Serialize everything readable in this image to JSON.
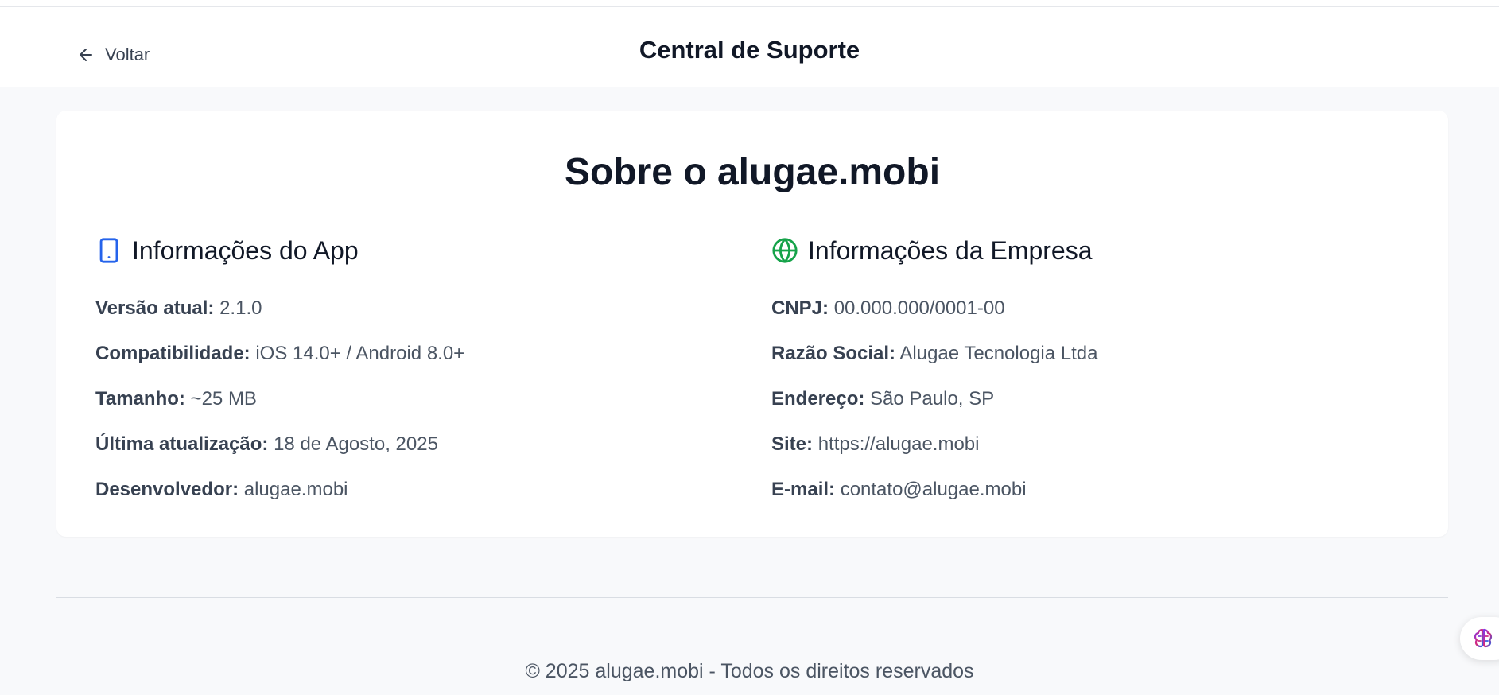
{
  "header": {
    "back_label": "Voltar",
    "title": "Central de Suporte"
  },
  "card": {
    "title": "Sobre o alugae.mobi",
    "app": {
      "heading": "Informações do App",
      "icon": "smartphone-icon",
      "rows": [
        {
          "label": "Versão atual:",
          "value": "2.1.0"
        },
        {
          "label": "Compatibilidade:",
          "value": "iOS 14.0+ / Android 8.0+"
        },
        {
          "label": "Tamanho:",
          "value": "~25 MB"
        },
        {
          "label": "Última atualização:",
          "value": "18 de Agosto, 2025"
        },
        {
          "label": "Desenvolvedor:",
          "value": "alugae.mobi"
        }
      ]
    },
    "company": {
      "heading": "Informações da Empresa",
      "icon": "globe-icon",
      "rows": [
        {
          "label": "CNPJ:",
          "value": "00.000.000/0001-00"
        },
        {
          "label": "Razão Social:",
          "value": "Alugae Tecnologia Ltda"
        },
        {
          "label": "Endereço:",
          "value": "São Paulo, SP"
        },
        {
          "label": "Site:",
          "value": "https://alugae.mobi"
        },
        {
          "label": "E-mail:",
          "value": "contato@alugae.mobi"
        }
      ]
    }
  },
  "footer": {
    "text": "© 2025 alugae.mobi - Todos os direitos reservados"
  },
  "fab": {
    "icon": "brain-icon"
  },
  "colors": {
    "app_icon": "#2563eb",
    "company_icon": "#16a34a",
    "page_bg": "#f8f9fb",
    "text_primary": "#111827"
  }
}
